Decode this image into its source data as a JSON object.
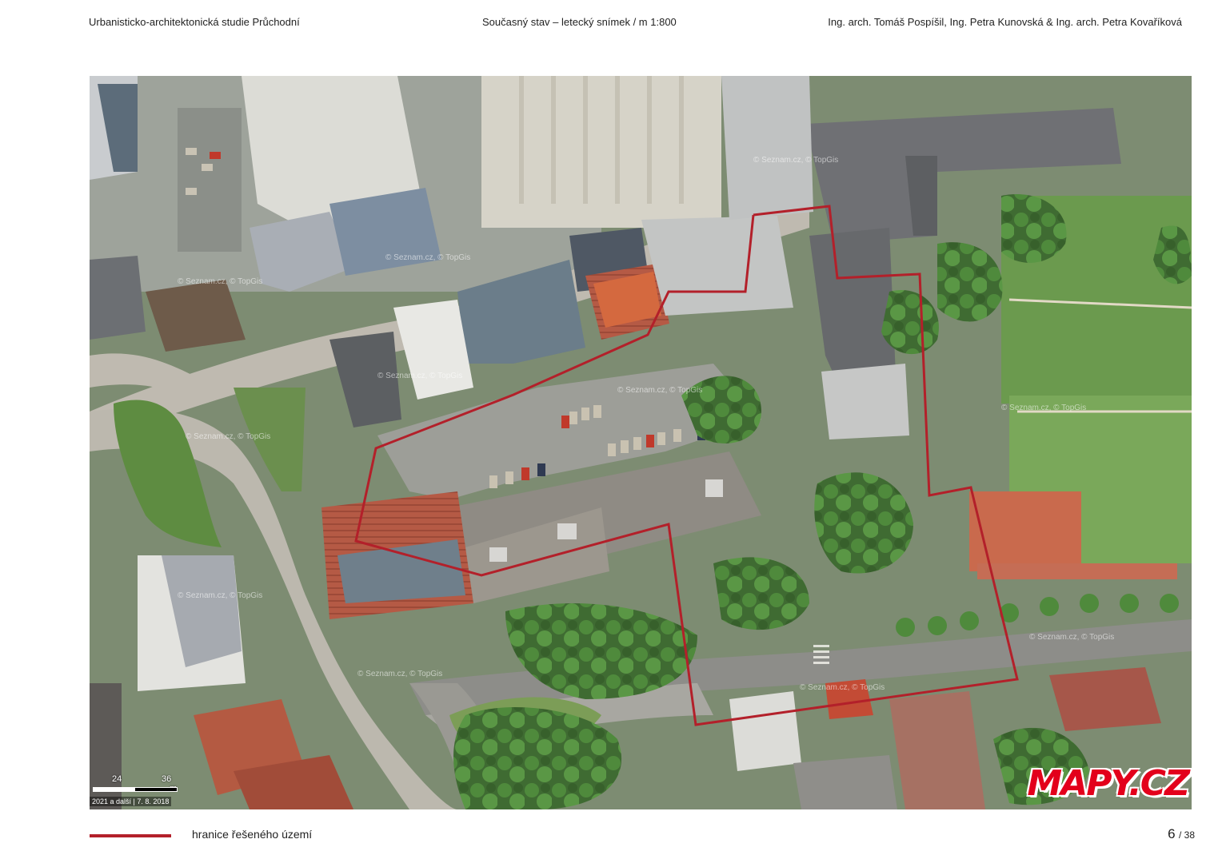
{
  "header": {
    "left": "Urbanisticko-architektonická studie Průchodní",
    "center": "Současný stav – letecký snímek / m 1:800",
    "right": "Ing. arch. Tomáš Pospíšil, Ing. Petra Kunovská & Ing. arch. Petra Kovaříková"
  },
  "map": {
    "watermark": "© Seznam.cz, © TopGis",
    "scale": {
      "tick_a": "24",
      "tick_b": "36",
      "unit": "m"
    },
    "attribution": "2021 a další | 7. 8. 2018",
    "logo": "MAPY.CZ",
    "boundary_color": "#b3202a"
  },
  "legend": {
    "label": "hranice řešeného území",
    "color": "#b3202a"
  },
  "page": {
    "current": "6",
    "total": "/ 38"
  }
}
